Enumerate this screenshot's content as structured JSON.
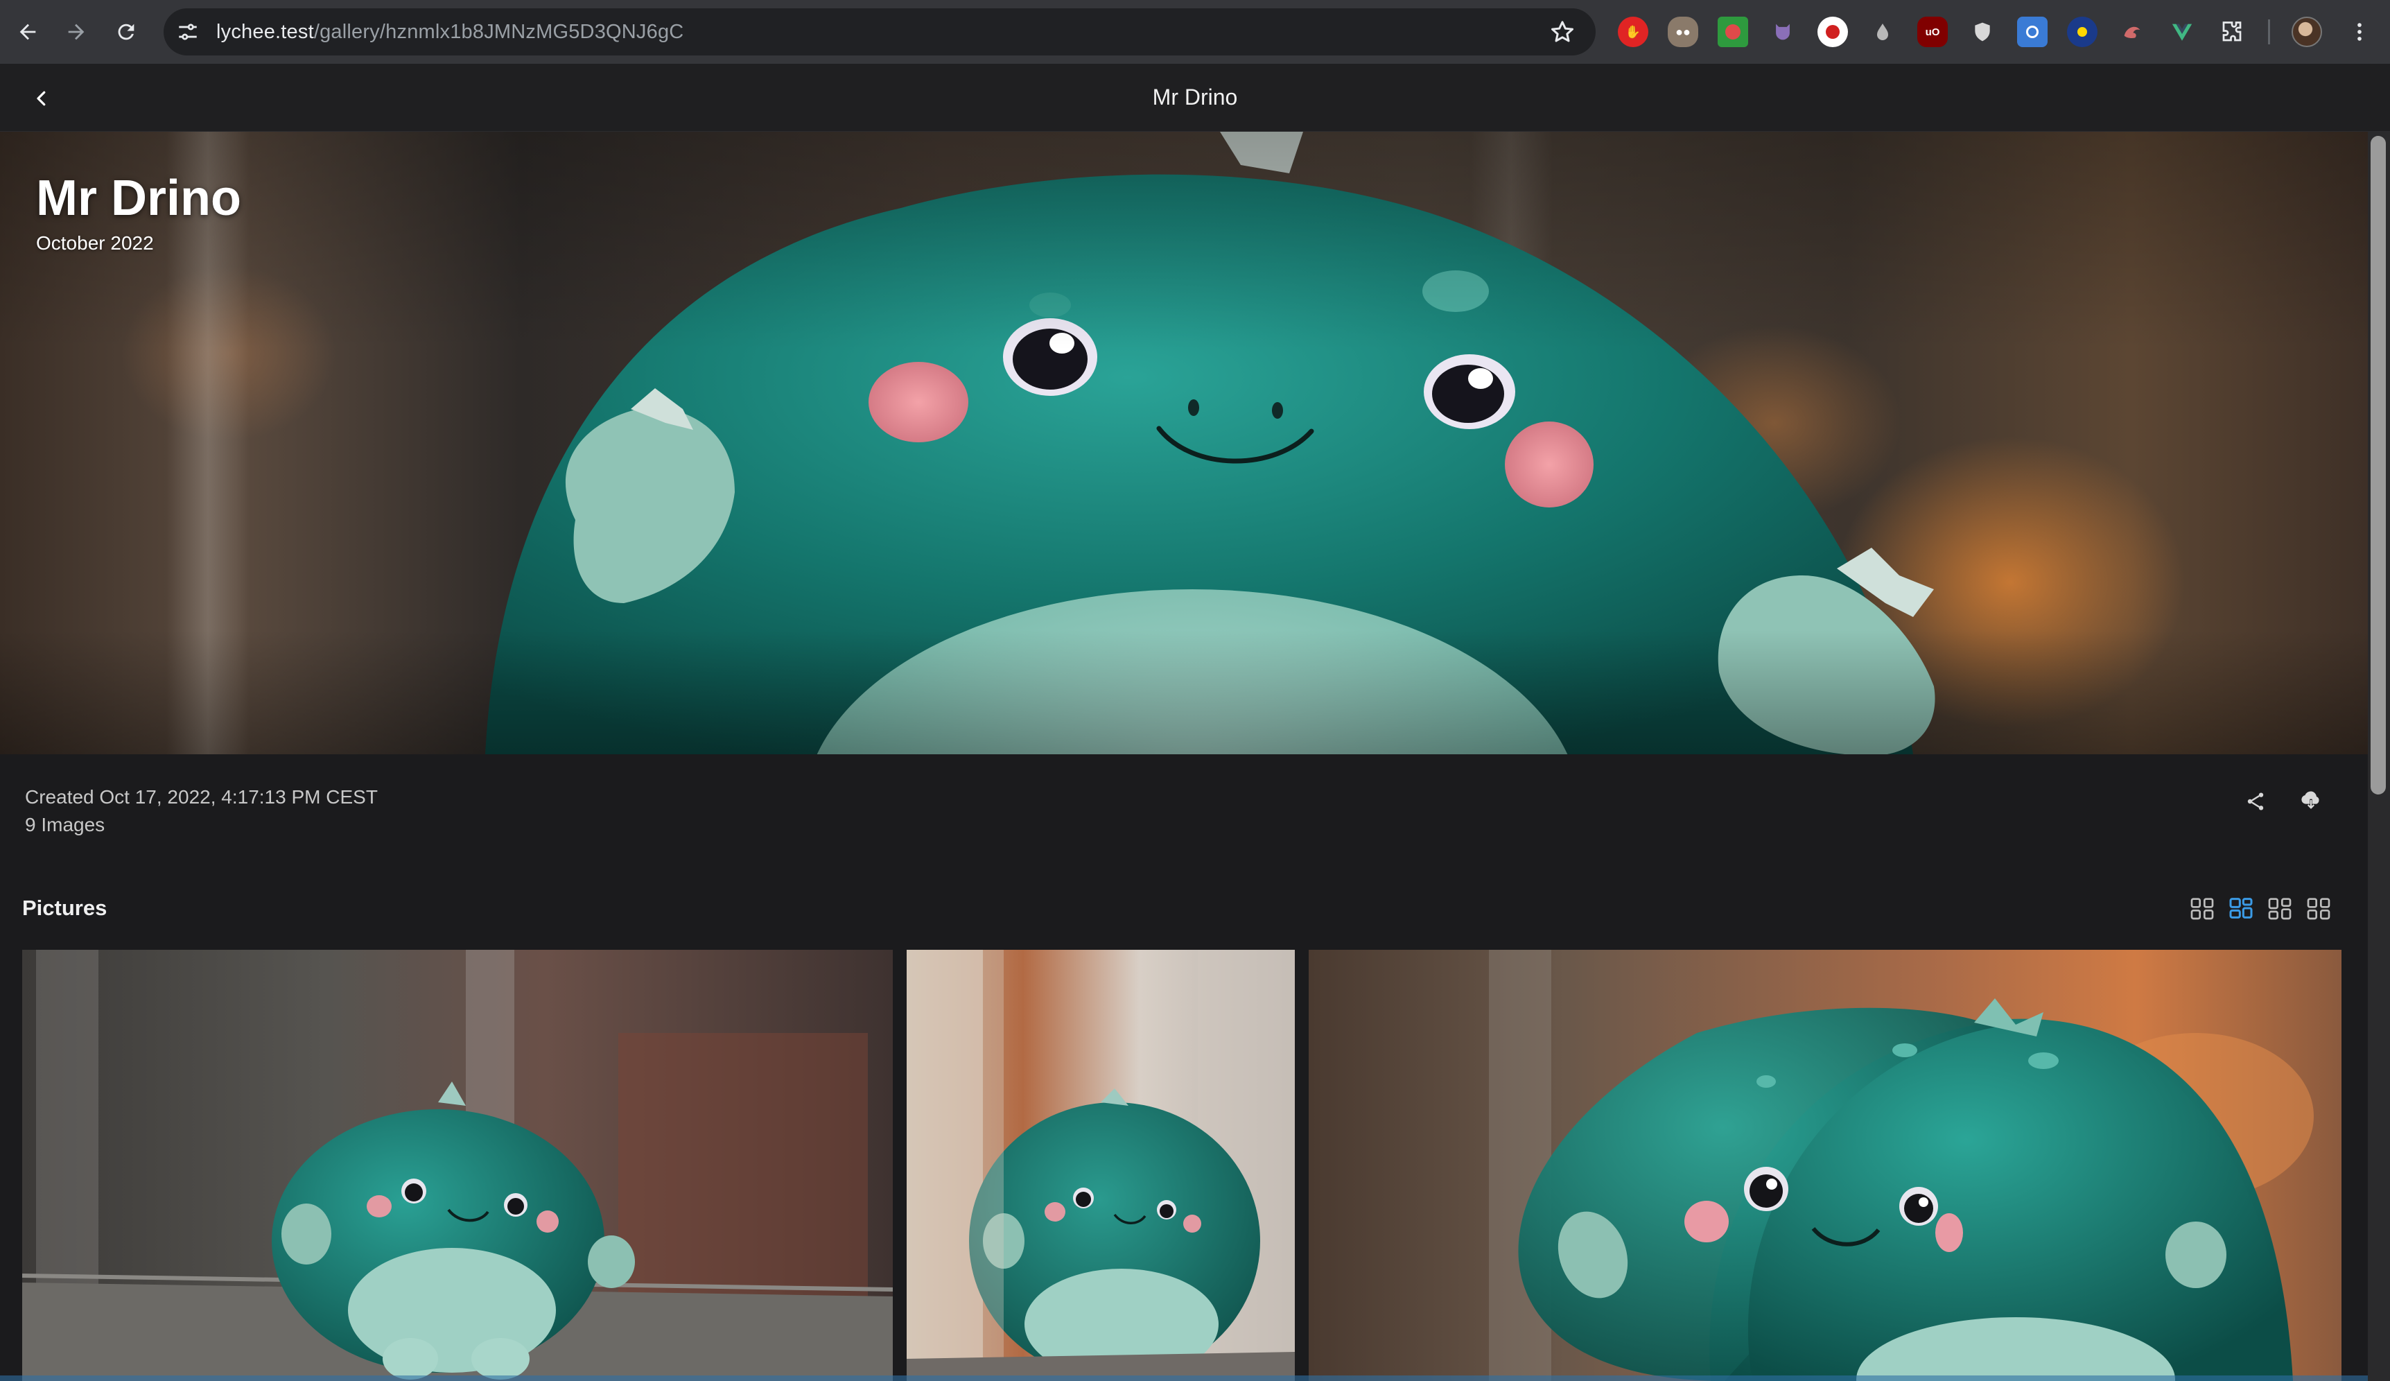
{
  "browser": {
    "url_host": "lychee.test",
    "url_path": "/gallery/hznmlx1b8JMNzMG5D3QNJ6gC",
    "icons": [
      "back-arrow-icon",
      "forward-arrow-icon",
      "reload-icon",
      "site-settings-icon",
      "bookmark-star-icon",
      "extensions-puzzle-icon",
      "profile-avatar",
      "more-vert-icon"
    ],
    "extensions": [
      "extension-red-hand-icon",
      "extension-owl-icon",
      "extension-green-icon",
      "extension-purple-icon",
      "extension-record-icon",
      "extension-drop-icon",
      "extension-ublock-icon",
      "extension-shield-icon",
      "extension-screen-icon",
      "extension-blue-icon",
      "extension-shell-icon",
      "extension-vue-icon"
    ]
  },
  "header": {
    "title": "Mr Drino",
    "back_icon": "chevron-left-icon"
  },
  "hero": {
    "title": "Mr Drino",
    "subtitle": "October 2022"
  },
  "album": {
    "created": "Created Oct 17, 2022, 4:17:13 PM CEST",
    "count": "9 Images",
    "actions": [
      "share-icon",
      "download-cloud-icon"
    ]
  },
  "pictures": {
    "title": "Pictures",
    "layouts": [
      {
        "name": "squares",
        "active": false
      },
      {
        "name": "justified",
        "active": true
      },
      {
        "name": "masonry",
        "active": false
      },
      {
        "name": "grid",
        "active": false
      }
    ]
  },
  "colors": {
    "accent": "#3b9be6",
    "background": "#1b1b1d",
    "plush_teal": "#1f8a80"
  }
}
